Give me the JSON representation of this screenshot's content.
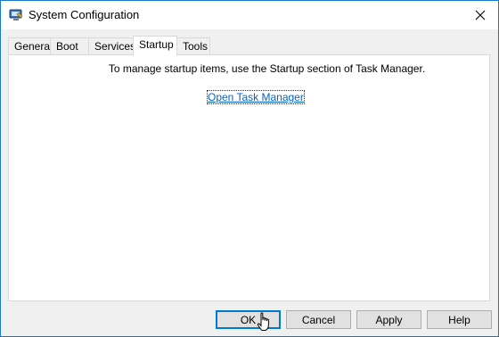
{
  "window": {
    "title": "System Configuration",
    "icon": "system-config-icon",
    "close_icon": "close-icon",
    "accent_color": "#1979ca"
  },
  "tabs": [
    {
      "label": "General",
      "active": false
    },
    {
      "label": "Boot",
      "active": false
    },
    {
      "label": "Services",
      "active": false
    },
    {
      "label": "Startup",
      "active": true
    },
    {
      "label": "Tools",
      "active": false
    }
  ],
  "startup": {
    "message": "To manage startup items, use the Startup section of Task Manager.",
    "link_label": "Open Task Manager",
    "link_color": "#0066cc"
  },
  "buttons": {
    "ok_label": "OK",
    "cancel_label": "Cancel",
    "apply_label": "Apply",
    "help_label": "Help"
  },
  "cursor": "hand-pointer-icon"
}
